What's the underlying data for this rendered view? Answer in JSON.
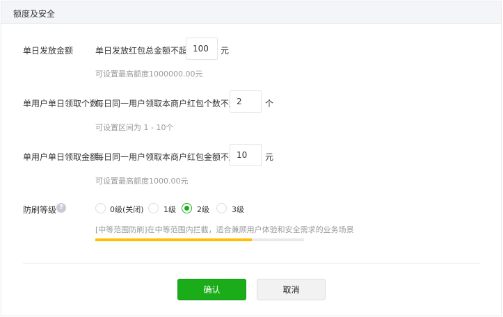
{
  "panel": {
    "title": "额度及安全"
  },
  "daily_amount": {
    "label": "单日发放金额",
    "desc": "单日发放红包总金额不超过",
    "value": "100",
    "unit": "元",
    "hint": "可设置最高额度1000000.00元"
  },
  "per_user_count": {
    "label": "单用户单日领取个数",
    "desc": "每日同一用户领取本商户红包个数不超过",
    "value": "2",
    "unit": "个",
    "hint": "可设置区间为 1 - 10个"
  },
  "per_user_amount": {
    "label": "单用户单日领取金额",
    "desc": "每日同一用户领取本商户红包金额不超过",
    "value": "10",
    "unit": "元",
    "hint": "可设置最高额度1000.00元"
  },
  "anti_fraud": {
    "label": "防刷等级",
    "help_icon": "?",
    "options": [
      {
        "label": "0级(关闭)",
        "checked": false
      },
      {
        "label": "1级",
        "checked": false
      },
      {
        "label": "2级",
        "checked": true
      },
      {
        "label": "3级",
        "checked": false
      }
    ],
    "hint": "[中等范围防刷]在中等范围内拦截，适合兼顾用户体验和安全需求的业务场景",
    "level_fraction": 0.75,
    "level_color": "#ffbe00"
  },
  "actions": {
    "confirm": "确认",
    "cancel": "取消"
  },
  "colors": {
    "accent": "#1aad19",
    "progress": "#ffbe00"
  }
}
